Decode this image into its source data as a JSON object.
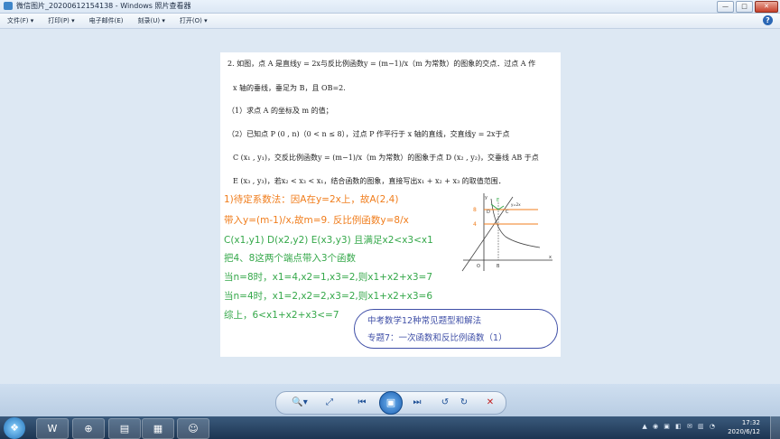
{
  "window": {
    "title": "微信图片_20200612154138 - Windows 照片查看器",
    "buttons": {
      "minimize": "—",
      "maximize": "□",
      "close": "✕"
    }
  },
  "menubar": {
    "items": [
      "文件(F) ▾",
      "打印(P) ▾",
      "电子邮件(E)",
      "刻录(U) ▾",
      "打开(O) ▾"
    ],
    "help": "?"
  },
  "photo": {
    "question": [
      "2.  如图，点 A 是直线y = 2x与反比例函数y = (m−1)/x（m 为常数）的图象的交点．过点 A 作",
      "x 轴的垂线，垂足为 B，且 OB=2.",
      "（1）求点 A 的坐标及 m 的值；",
      "（2）已知点 P (0 , n)（0 < n ≤ 8），过点 P 作平行于 x 轴的直线，交直线y = 2x于点",
      "C (x₁ , y₁)，交反比例函数y = (m−1)/x（m 为常数）的图象于点 D (x₂ , y₂)，交垂线 AB 于点",
      "E (x₃ , y₃)，若x₂ < x₃ < x₁，结合函数的图象，直接写出x₁ + x₂ + x₃ 的取值范围．"
    ],
    "solution_orange": [
      "1)待定系数法：因A在y=2x上，故A(2,4)",
      "带入y=(m-1)/x,故m=9. 反比例函数y=8/x"
    ],
    "solution_green": [
      "C(x1,y1) D(x2,y2) E(x3,y3) 且满足x2<x3<x1",
      "把4、8这两个端点带入3个函数",
      "当n=8时，x1=4,x2=1,x3=2,则x1+x2+x3=7",
      "当n=4时，x1=2,x2=2,x3=2,则x1+x2+x3=6",
      "综上，6<x1+x2+x3<=7"
    ],
    "graph_labels": {
      "y": "y",
      "x": "x",
      "o": "O",
      "b": "B",
      "e": "E",
      "d": "D",
      "c": "C",
      "line": "y=2x",
      "eight": "8",
      "four": "4"
    },
    "note": [
      "中考数学12种常见题型和解法",
      "专题7：一次函数和反比例函数（1）"
    ]
  },
  "controls": {
    "zoom": "🔍▾",
    "fit": "⤢",
    "prev": "⏮",
    "play": "▣",
    "next": "⏭",
    "rotate_ccw": "↺",
    "rotate_cw": "↻",
    "delete": "✕"
  },
  "taskbar": {
    "start": "❖",
    "apps": [
      "W",
      "⊕",
      "▤",
      "▦",
      "☺"
    ],
    "tray": "▲ ◉ ▣ ◧ ✉ ▥ ◔",
    "time": "17:32",
    "date": "2020/6/12"
  },
  "colors": {
    "accent": "#1d5fb0",
    "orange": "#f07d1c",
    "green": "#35a84a",
    "note": "#3f4fa7"
  }
}
